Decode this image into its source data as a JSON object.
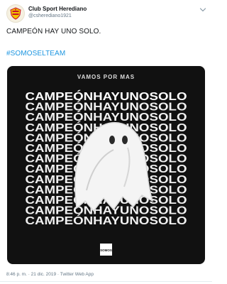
{
  "author": {
    "display_name": "Club Sport Herediano",
    "handle": "@csherediano1921",
    "avatar_icon": "club-crest-icon"
  },
  "tweet": {
    "text": "CAMPEÓN HAY UNO SOLO.",
    "hashtag": "#SOMOSELTEAM",
    "timestamp": "8:46 p. m. · 21 dic. 2019 · Twitter Web App"
  },
  "media": {
    "top_label": "VAMOS POR MAS",
    "repeated_line": "CAMPEÓNHAYUNOSOLO",
    "line_count": 13,
    "badge_text": "SOMOS",
    "figure_icon": "ghost-icon"
  },
  "colors": {
    "hashtag": "#1b95e0",
    "media_background": "#111111",
    "media_text": "#ffffff",
    "crest_red": "#c8102e",
    "crest_yellow": "#f2c400"
  }
}
